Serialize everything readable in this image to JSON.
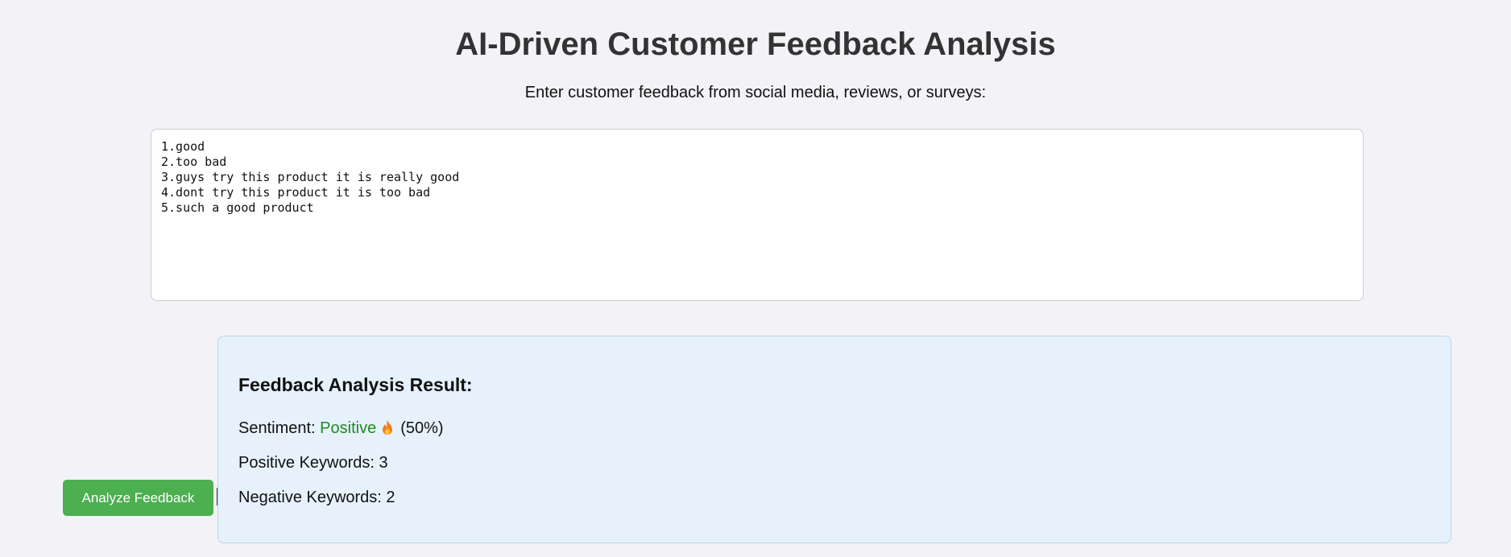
{
  "header": {
    "title": "AI-Driven Customer Feedback Analysis",
    "instructions": "Enter customer feedback from social media, reviews, or surveys:"
  },
  "feedback_input": {
    "value": "1.good\n2.too bad\n3.guys try this product it is really good\n4.dont try this product it is too bad\n5.such a good product",
    "placeholder": ""
  },
  "actions": {
    "analyze_label": "Analyze Feedback"
  },
  "result": {
    "heading": "Feedback Analysis Result:",
    "sentiment_label": "Sentiment:",
    "sentiment_value": "Positive",
    "sentiment_icon": "fire-icon",
    "sentiment_percent": "(50%)",
    "positive_keywords_text": "Positive Keywords: 3",
    "negative_keywords_text": "Negative Keywords: 2"
  },
  "colors": {
    "page_background": "#f3f3f7",
    "button_background": "#4caf50",
    "result_background": "#e6f1fc",
    "positive_text": "#1f8a1f"
  }
}
